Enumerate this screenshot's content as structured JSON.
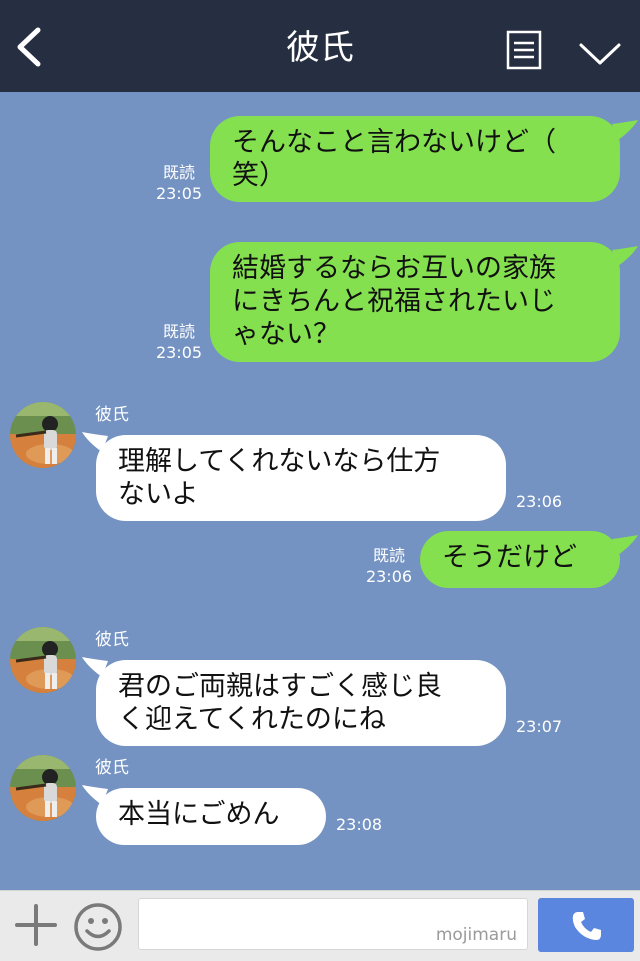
{
  "header": {
    "title": "彼氏",
    "back_icon": "back-chevron-icon",
    "menu_icon": "note-menu-icon",
    "expand_icon": "chevron-down-icon"
  },
  "colors": {
    "header_bg": "#262e42",
    "chat_bg": "#7493c2",
    "sent_bubble": "#84e04f",
    "received_bubble": "#ffffff",
    "call_button": "#5b86e0"
  },
  "messages": [
    {
      "type": "sent",
      "lines": [
        "そんなこと言わないけど（",
        "笑）"
      ],
      "read_label": "既読",
      "time": "23:05"
    },
    {
      "type": "sent",
      "lines": [
        "結婚するならお互いの家族",
        "にきちんと祝福されたいじ",
        "ゃない？"
      ],
      "read_label": "既読",
      "time": "23:05"
    },
    {
      "type": "received",
      "sender": "彼氏",
      "lines": [
        "理解してくれないなら仕方",
        "ないよ"
      ],
      "time": "23:06"
    },
    {
      "type": "sent",
      "lines": [
        "そうだけど"
      ],
      "read_label": "既読",
      "time": "23:06"
    },
    {
      "type": "received",
      "sender": "彼氏",
      "lines": [
        "君のご両親はすごく感じ良",
        "く迎えてくれたのにね"
      ],
      "time": "23:07"
    },
    {
      "type": "received",
      "sender": "彼氏",
      "lines": [
        "本当にごめん"
      ],
      "time": "23:08"
    }
  ],
  "footer": {
    "plus_icon": "plus-icon",
    "emoji_icon": "smiley-icon",
    "input_value": "",
    "watermark": "mojimaru",
    "call_icon": "phone-icon"
  }
}
